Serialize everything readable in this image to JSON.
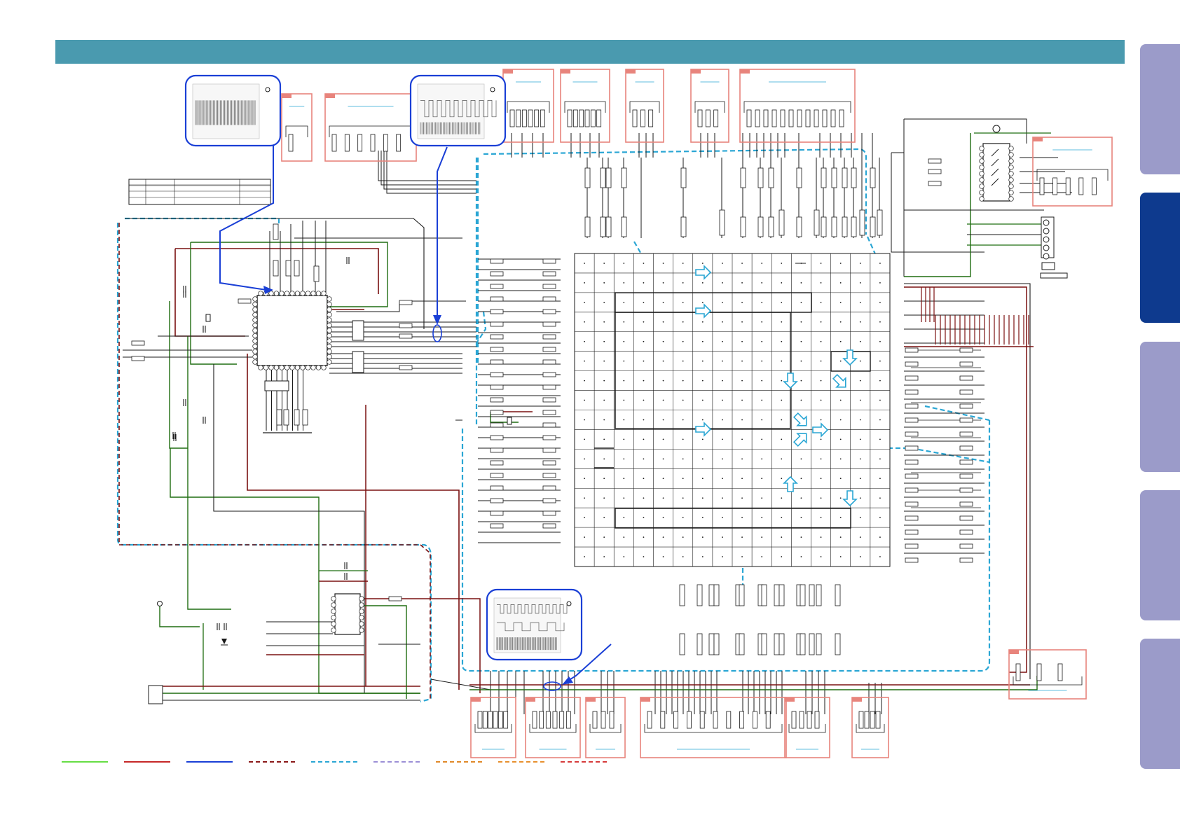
{
  "colors": {
    "header_bar": "#4a9aaf",
    "side_tab_inactive": "#9b9bc9",
    "side_tab_active": "#0e3a8e",
    "wire_black": "#1a1a1a",
    "wire_green": "#1f6d10",
    "wire_darkred": "#7a1010",
    "block_outline_cyan": "#2aa6d4",
    "callout_blue": "#1a3fd6",
    "connector_box_pink": "#e8847c",
    "legend_green": "#66dd44",
    "legend_red": "#c62828",
    "legend_blue": "#1a3fd6",
    "legend_darkred_dashed": "#8b1a1a",
    "legend_cyan_dashed": "#2aa6d4",
    "legend_lavender_dashed": "#9b8fd6",
    "legend_orange_dashed": "#e08a2a",
    "legend_orange_dashed_2": "#e8902e",
    "legend_red_dashed": "#d63a3a"
  },
  "side_tabs": [
    {
      "name": "tab-1",
      "state": "inactive"
    },
    {
      "name": "tab-2",
      "state": "active"
    },
    {
      "name": "tab-3",
      "state": "inactive"
    },
    {
      "name": "tab-4",
      "state": "inactive"
    },
    {
      "name": "tab-5",
      "state": "inactive"
    }
  ],
  "legend": [
    {
      "style": "solid",
      "color": "legend_green"
    },
    {
      "style": "solid",
      "color": "legend_red"
    },
    {
      "style": "solid",
      "color": "legend_blue"
    },
    {
      "style": "dashed",
      "color": "legend_darkred_dashed"
    },
    {
      "style": "dashed",
      "color": "legend_cyan_dashed"
    },
    {
      "style": "dashed",
      "color": "legend_lavender_dashed"
    },
    {
      "style": "dashed",
      "color": "legend_orange_dashed"
    },
    {
      "style": "dashed",
      "color": "legend_orange_dashed_2"
    },
    {
      "style": "dashed",
      "color": "legend_red_dashed"
    }
  ],
  "icons": {
    "waveform_scope": "oscilloscope-waveform-icon",
    "flow_arrow": "signal-flow-arrow-icon",
    "chip": "integrated-circuit-icon",
    "connector": "connector-icon"
  }
}
